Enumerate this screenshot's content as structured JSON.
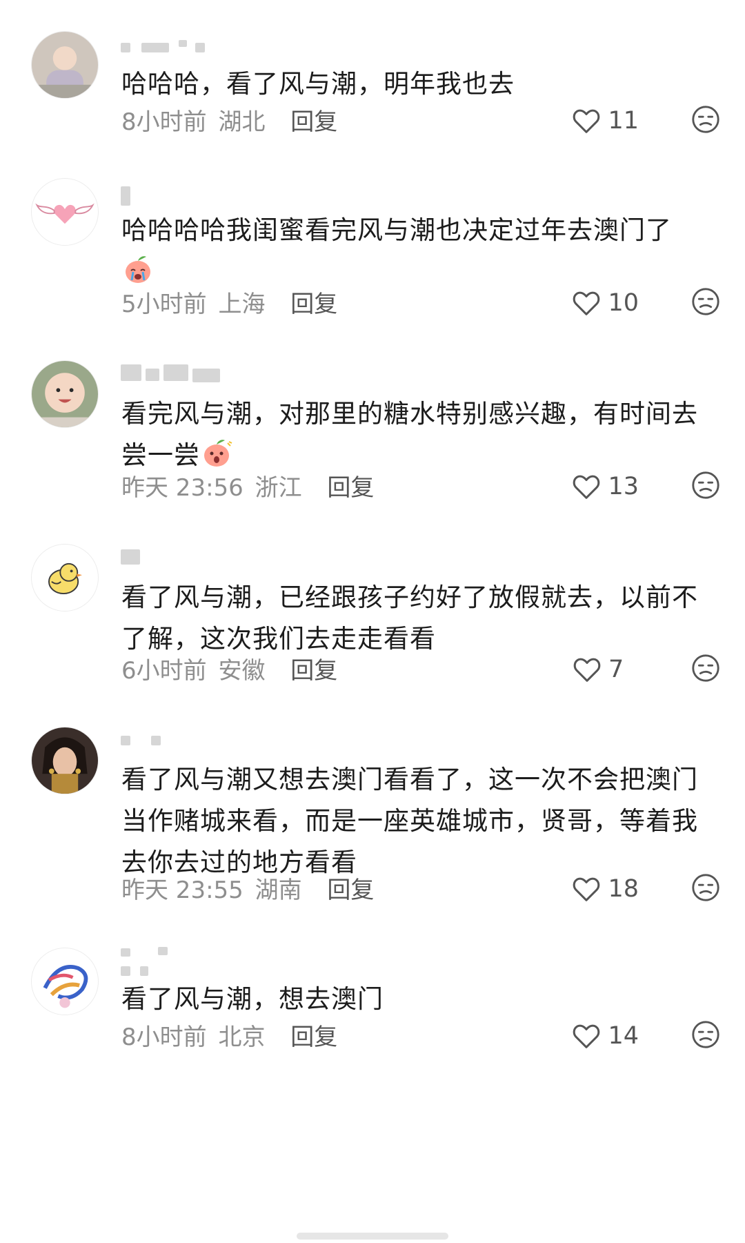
{
  "comments": [
    {
      "text": "哈哈哈，看了风与潮，明年我也去",
      "time": "8小时前",
      "region": "湖北",
      "reply": "回复",
      "likes": "11",
      "avatar_icon": "baby-photo-avatar"
    },
    {
      "text": "哈哈哈哈我闺蜜看完风与潮也决定过年去澳门了",
      "emoji": "crying-peach-emoji",
      "time": "5小时前",
      "region": "上海",
      "reply": "回复",
      "likes": "10",
      "avatar_icon": "winged-heart-avatar"
    },
    {
      "text": "看完风与潮，对那里的糖水特别感兴趣，有时间去尝一尝",
      "emoji": "surprised-peach-emoji",
      "time": "昨天 23:56",
      "region": "浙江",
      "reply": "回复",
      "likes": "13",
      "avatar_icon": "smiling-baby-avatar"
    },
    {
      "text": "看了风与潮，已经跟孩子约好了放假就去，以前不了解，这次我们去走走看看",
      "time": "6小时前",
      "region": "安徽",
      "reply": "回复",
      "likes": "7",
      "avatar_icon": "yellow-chick-avatar"
    },
    {
      "text": "看了风与潮又想去澳门看看了，这一次不会把澳门当作赌城来看，而是一座英雄城市，贤哥，等着我去你去过的地方看看",
      "time": "昨天 23:55",
      "region": "湖南",
      "reply": "回复",
      "likes": "18",
      "avatar_icon": "woman-portrait-avatar"
    },
    {
      "text": "看了风与潮，想去澳门",
      "time": "8小时前",
      "region": "北京",
      "reply": "回复",
      "likes": "14",
      "avatar_icon": "colorful-swirl-avatar"
    }
  ],
  "colors": {
    "text": "#1c1c1c",
    "meta": "#8e8e8e",
    "icon": "#555555",
    "background": "#ffffff"
  },
  "icons": [
    "heart-icon",
    "dislike-face-icon"
  ]
}
